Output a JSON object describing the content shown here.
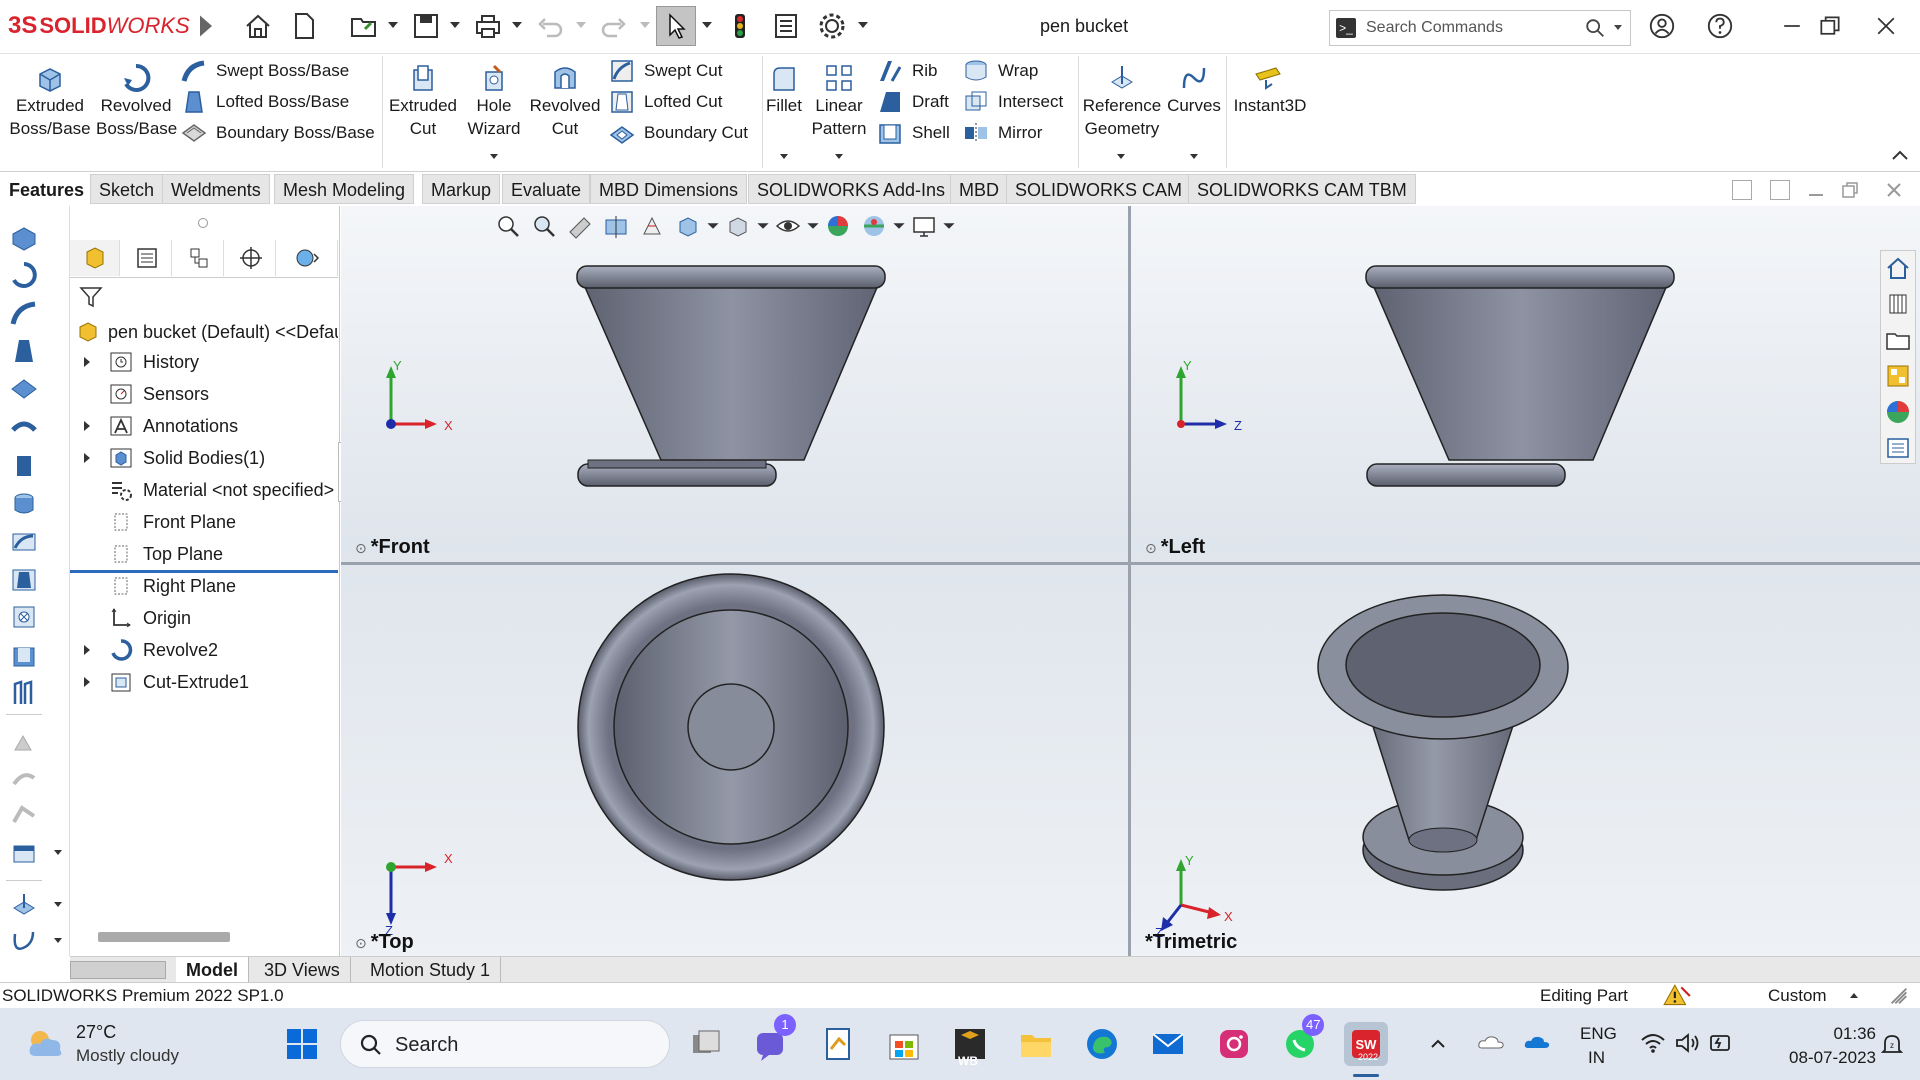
{
  "app": {
    "logo_text_ds": "3S",
    "logo_text_solid": "SOLID",
    "logo_text_works": "WORKS",
    "document_title": "pen bucket",
    "brand_color": "#d9232d"
  },
  "search": {
    "placeholder": "Search Commands"
  },
  "ribbon": {
    "extruded_boss": "Extruded Boss/Base",
    "revolved_boss": "Revolved Boss/Base",
    "swept_boss": "Swept Boss/Base",
    "lofted_boss": "Lofted Boss/Base",
    "boundary_boss": "Boundary Boss/Base",
    "extruded_cut": "Extruded Cut",
    "hole_wizard": "Hole Wizard",
    "revolved_cut": "Revolved Cut",
    "swept_cut": "Swept Cut",
    "lofted_cut": "Lofted Cut",
    "boundary_cut": "Boundary Cut",
    "fillet": "Fillet",
    "linear_pattern": "Linear Pattern",
    "rib": "Rib",
    "draft": "Draft",
    "shell": "Shell",
    "wrap": "Wrap",
    "intersect": "Intersect",
    "mirror": "Mirror",
    "reference_geometry": "Reference Geometry",
    "curves": "Curves",
    "instant3d": "Instant3D"
  },
  "tabs": [
    "Features",
    "Sketch",
    "Weldments",
    "Mesh Modeling",
    "Markup",
    "Evaluate",
    "MBD Dimensions",
    "SOLIDWORKS Add-Ins",
    "MBD",
    "SOLIDWORKS CAM",
    "SOLIDWORKS CAM TBM"
  ],
  "tree": {
    "root": "pen bucket (Default) <<Default>",
    "items": [
      {
        "label": "History",
        "icon": "history-icon",
        "expandable": true
      },
      {
        "label": "Sensors",
        "icon": "sensors-icon",
        "expandable": false
      },
      {
        "label": "Annotations",
        "icon": "annotations-icon",
        "expandable": true
      },
      {
        "label": "Solid Bodies(1)",
        "icon": "solid-bodies-icon",
        "expandable": true
      },
      {
        "label": "Material <not specified>",
        "icon": "material-icon",
        "expandable": false
      },
      {
        "label": "Front Plane",
        "icon": "plane-icon",
        "expandable": false
      },
      {
        "label": "Top Plane",
        "icon": "plane-icon",
        "expandable": false
      },
      {
        "label": "Right Plane",
        "icon": "plane-icon",
        "expandable": false
      },
      {
        "label": "Origin",
        "icon": "origin-icon",
        "expandable": false
      },
      {
        "label": "Revolve2",
        "icon": "revolve-icon",
        "expandable": true
      },
      {
        "label": "Cut-Extrude1",
        "icon": "cut-extrude-icon",
        "expandable": true
      }
    ]
  },
  "views": {
    "front": "*Front",
    "left": "*Left",
    "top": "*Top",
    "trimetric": "*Trimetric"
  },
  "axes": {
    "x": "X",
    "y": "Y",
    "z": "Z"
  },
  "bottom_tabs": [
    "Model",
    "3D Views",
    "Motion Study 1"
  ],
  "status": {
    "version": "SOLIDWORKS Premium 2022 SP1.0",
    "mode": "Editing Part",
    "units": "Custom"
  },
  "taskbar": {
    "temperature": "27°C",
    "weather": "Mostly cloudy",
    "search_placeholder": "Search",
    "teams_badge": "1",
    "whatsapp_badge": "47",
    "sw_label": "2022",
    "wb_label": "WB",
    "lang": "ENG",
    "region": "IN",
    "time": "01:36",
    "date": "08-07-2023"
  }
}
